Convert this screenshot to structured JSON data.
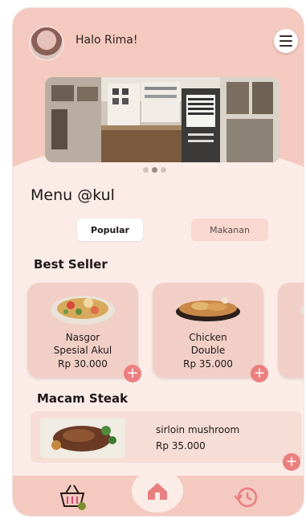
{
  "header": {
    "greeting": "Halo Rima!"
  },
  "title": "Menu @kul",
  "tabs": [
    {
      "label": "Popular"
    },
    {
      "label": "Makanan"
    }
  ],
  "best_seller": {
    "title": "Best Seller",
    "items": [
      {
        "name_line1": "Nasgor",
        "name_line2": "Spesial Akul",
        "price": "Rp 30.000"
      },
      {
        "name_line1": "Chicken",
        "name_line2": "Double",
        "price": "Rp 35.000"
      }
    ]
  },
  "steak": {
    "title": "Macam Steak",
    "item": {
      "name": "sirloin mushroom",
      "price": "Rp 35.000"
    }
  },
  "plus_symbol": "+",
  "colors": {
    "header_pink": "#f4c9bf",
    "background": "#fbece8",
    "card": "#f2cfc6",
    "accent": "#ec7f7f"
  },
  "nav": {
    "icons": [
      "basket-icon",
      "home-icon",
      "history-icon"
    ]
  }
}
